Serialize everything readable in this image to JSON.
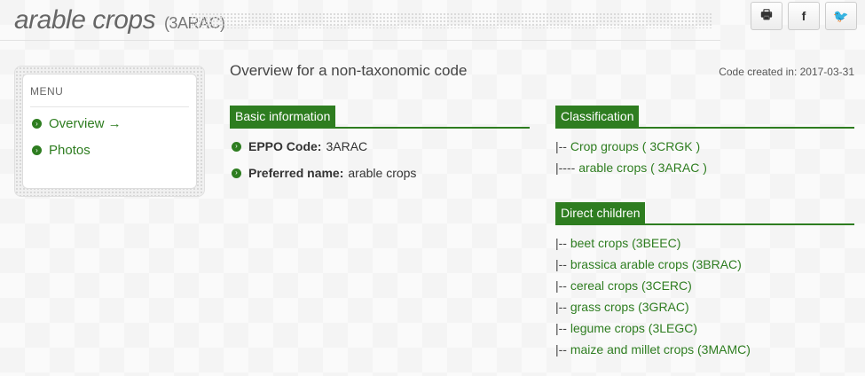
{
  "header": {
    "title": "arable crops",
    "code": "(3ARAC)"
  },
  "share": {
    "print_icon": "🖶",
    "facebook_icon": "f",
    "twitter_icon": "🐦"
  },
  "menu": {
    "title": "MENU",
    "items": [
      {
        "label": "Overview →"
      },
      {
        "label": "Photos"
      }
    ]
  },
  "main": {
    "heading": "Overview for a non-taxonomic code",
    "code_created": "Code created in: 2017-03-31",
    "basic_info": {
      "title": "Basic information",
      "eppo_label": "EPPO Code:",
      "eppo_value": "3ARAC",
      "name_label": "Preferred name:",
      "name_value": "arable crops"
    },
    "classification": {
      "title": "Classification",
      "items": [
        {
          "prefix": "|-- ",
          "label": "Crop groups ( 3CRGK )"
        },
        {
          "prefix": "|---- ",
          "label": "arable crops ( 3ARAC )"
        }
      ]
    },
    "children": {
      "title": "Direct children",
      "items": [
        {
          "prefix": "|-- ",
          "label": "beet crops (3BEEC)"
        },
        {
          "prefix": "|-- ",
          "label": "brassica arable crops (3BRAC)"
        },
        {
          "prefix": "|-- ",
          "label": "cereal crops (3CERC)"
        },
        {
          "prefix": "|-- ",
          "label": "grass crops (3GRAC)"
        },
        {
          "prefix": "|-- ",
          "label": "legume crops (3LEGC)"
        },
        {
          "prefix": "|-- ",
          "label": "maize and millet crops (3MAMC)"
        }
      ]
    }
  },
  "colors": {
    "accent": "#2e7d20"
  }
}
